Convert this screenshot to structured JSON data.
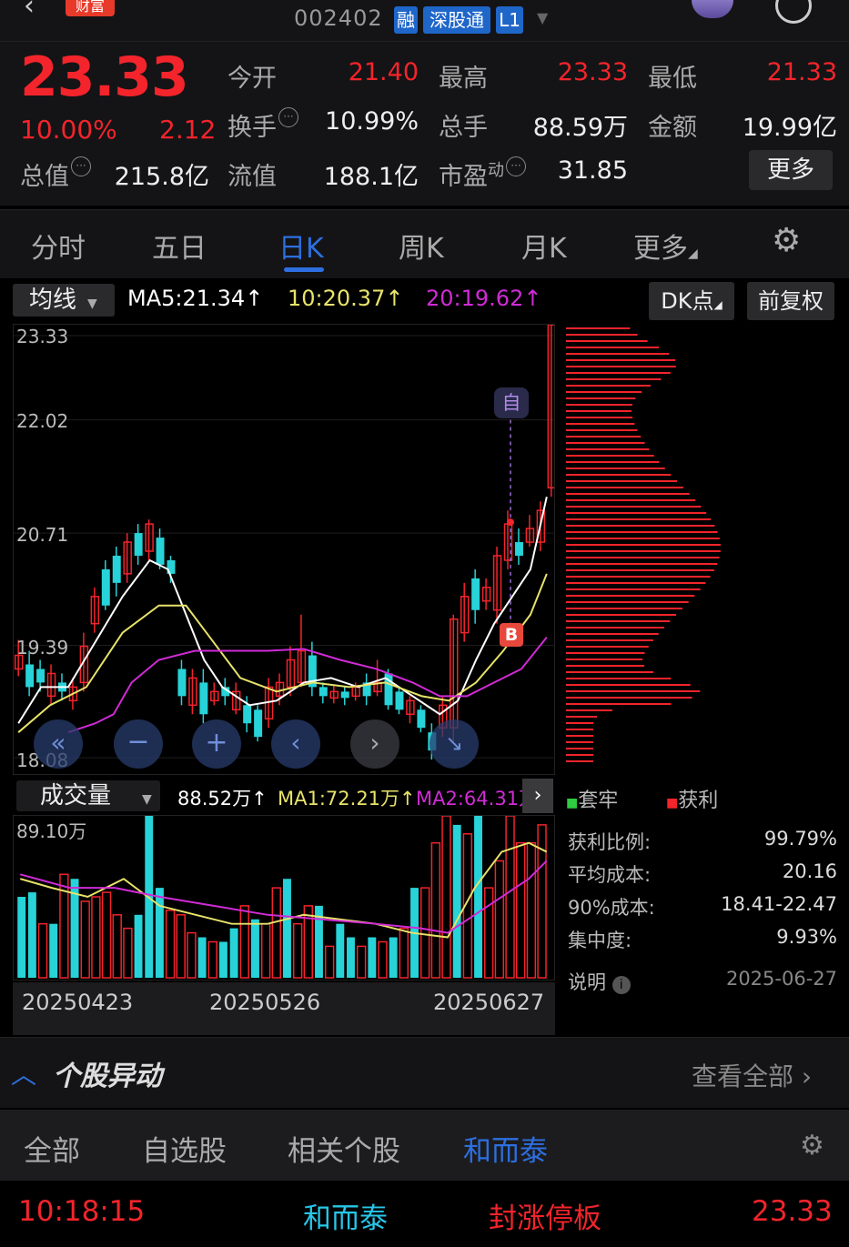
{
  "header": {
    "back_icon": "chevron-left-icon",
    "brand": "财富",
    "stock_code": "002402",
    "tags": [
      "融",
      "深股通",
      "L1"
    ],
    "avatar_icon": "mascot-avatar-icon",
    "search_icon": "search-icon"
  },
  "quote": {
    "price": "23.33",
    "change_pct": "10.00%",
    "change": "2.12",
    "open_label": "今开",
    "open": "21.40",
    "high_label": "最高",
    "high": "23.33",
    "low_label": "最低",
    "low": "21.33",
    "turnover_label": "换手",
    "turnover": "10.99%",
    "volume_label": "总手",
    "volume": "88.59万",
    "amount_label": "金额",
    "amount": "19.99亿",
    "mktcap_label": "总值",
    "mktcap": "215.8亿",
    "float_label": "流值",
    "float_cap": "188.1亿",
    "pe_label": "市盈",
    "pe_sup": "动",
    "pe": "31.85",
    "more_label": "更多"
  },
  "tabs": [
    "分时",
    "五日",
    "日K",
    "周K",
    "月K",
    "更多"
  ],
  "active_tab": "日K",
  "ma_bar": {
    "selector": "均线",
    "ma5": "MA5:21.34",
    "ma10": "10:20.37",
    "ma20": "20:19.62",
    "dk_label": "DK点",
    "adjust_label": "前复权"
  },
  "kline": {
    "y_ticks": [
      "23.33",
      "22.02",
      "20.71",
      "19.39",
      "18.08"
    ],
    "marker_self": "自",
    "marker_buy": "B"
  },
  "volume": {
    "selector": "成交量",
    "vol": "88.52万",
    "ma1": "MA1:72.21万",
    "ma2": "MA2:64.31万",
    "y_top": "89.10万",
    "dates": [
      "20250423",
      "20250526",
      "20250627"
    ]
  },
  "chips": {
    "legend_trapped": "套牢",
    "legend_profit": "获利",
    "stats": [
      {
        "label": "获利比例:",
        "value": "99.79%"
      },
      {
        "label": "平均成本:",
        "value": "20.16"
      },
      {
        "label": "90%成本:",
        "value": "18.41-22.47"
      },
      {
        "label": "集中度:",
        "value": "9.93%"
      }
    ],
    "note_label": "说明",
    "note_date": "2025-06-27"
  },
  "movement": {
    "title": "个股异动",
    "view_all": "查看全部",
    "tabs": [
      "全部",
      "自选股",
      "相关个股",
      "和而泰"
    ],
    "active_tab": "和而泰",
    "row": {
      "time": "10:18:15",
      "name": "和而泰",
      "event": "封涨停板",
      "price": "23.33"
    }
  },
  "colors": {
    "up": "#f3242b",
    "down": "#27d3d8",
    "ma5": "#ffffff",
    "ma10": "#e8e36a",
    "ma20": "#d02bd6",
    "accent": "#2d6fe0"
  }
}
